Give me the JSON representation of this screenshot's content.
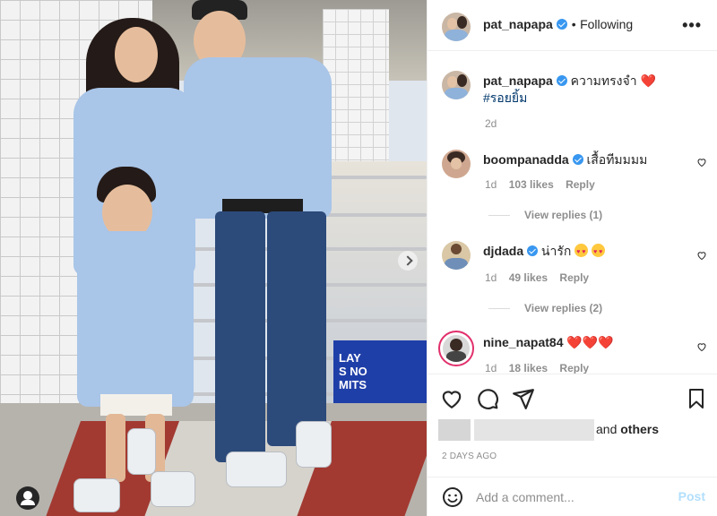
{
  "post": {
    "username": "pat_napapa",
    "follow_status": "Following",
    "more_label": "•••",
    "separator": "•"
  },
  "caption": {
    "username": "pat_napapa",
    "text": "ความทรงจำ",
    "emoji": "❤️",
    "hashtag": "#รอยยิ้ม",
    "age": "2d"
  },
  "comments": [
    {
      "username": "boompanadda",
      "verified": true,
      "text": "เสื้อทีมมมม",
      "age": "1d",
      "likes": "103 likes",
      "reply": "Reply",
      "view_replies": "View replies (1)"
    },
    {
      "username": "djdada",
      "verified": true,
      "text": "น่ารัก",
      "emoji_count": 2,
      "age": "1d",
      "likes": "49 likes",
      "reply": "Reply",
      "view_replies": "View replies (2)"
    },
    {
      "username": "nine_napat84",
      "verified": false,
      "text": "",
      "emoji": "❤️❤️❤️",
      "age": "1d",
      "likes": "18 likes",
      "reply": "Reply"
    }
  ],
  "likes": {
    "suffix": "and",
    "others": "others"
  },
  "timestamp": "2 DAYS AGO",
  "composer": {
    "placeholder": "Add a comment...",
    "post_label": "Post"
  },
  "photo": {
    "sign_text": "LAY\nS NO\nMITS"
  },
  "colors": {
    "link": "#00376b",
    "verified": "#3897f0",
    "heart": "#ed4956",
    "post_disabled": "#b2dffc",
    "muted": "#8e8e8e"
  },
  "icons": [
    "heart-icon",
    "comment-icon",
    "share-icon",
    "bookmark-icon",
    "emoji-icon",
    "more-icon",
    "tag-user-icon",
    "chevron-right-icon"
  ]
}
